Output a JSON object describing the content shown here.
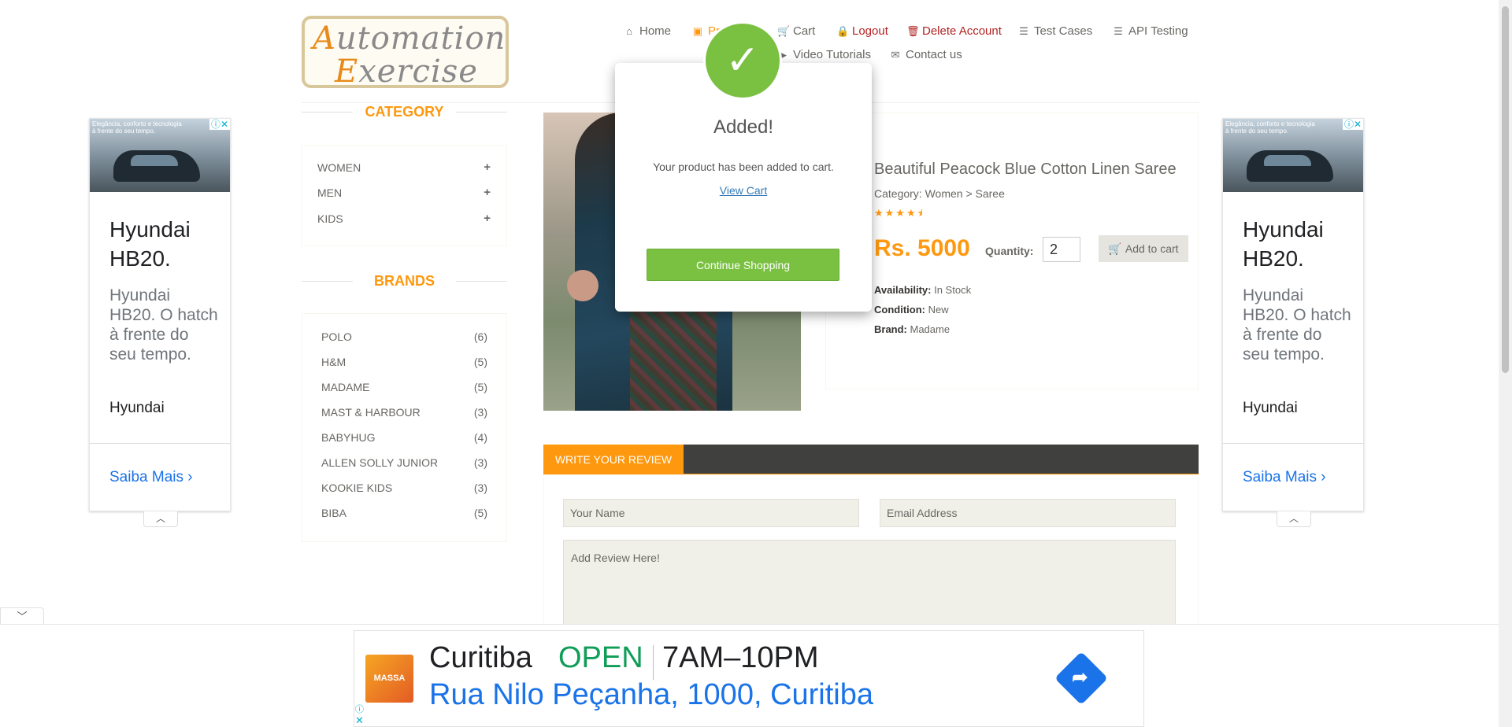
{
  "logo": {
    "line1_cap": "A",
    "line1_rest": "utomation",
    "line2_cap": "E",
    "line2_rest": "xercise"
  },
  "nav": {
    "home": "Home",
    "products": "Products",
    "cart": "Cart",
    "logout": "Logout",
    "delete_account": "Delete Account",
    "test_cases": "Test Cases",
    "api_testing": "API Testing",
    "video_tutorials": "Video Tutorials",
    "contact_us": "Contact us"
  },
  "side_ad": {
    "tagline": "Elegância, conforto e tecnologia à frente do seu tempo.",
    "title": "Hyundai HB20.",
    "description": "Hyundai HB20. O hatch à frente do seu tempo.",
    "brand": "Hyundai",
    "cta": "Saiba Mais"
  },
  "sidebar": {
    "category_title": "CATEGORY",
    "categories": [
      {
        "label": "WOMEN"
      },
      {
        "label": "MEN"
      },
      {
        "label": "KIDS"
      }
    ],
    "brands_title": "BRANDS",
    "brands": [
      {
        "name": "POLO",
        "count": "(6)"
      },
      {
        "name": "H&M",
        "count": "(5)"
      },
      {
        "name": "MADAME",
        "count": "(5)"
      },
      {
        "name": "MAST & HARBOUR",
        "count": "(3)"
      },
      {
        "name": "BABYHUG",
        "count": "(4)"
      },
      {
        "name": "ALLEN SOLLY JUNIOR",
        "count": "(3)"
      },
      {
        "name": "KOOKIE KIDS",
        "count": "(3)"
      },
      {
        "name": "BIBA",
        "count": "(5)"
      }
    ]
  },
  "product": {
    "name": "Beautiful Peacock Blue Cotton Linen Saree",
    "category": "Category: Women > Saree",
    "rating": 4.5,
    "price": "Rs. 5000",
    "quantity_label": "Quantity:",
    "quantity": "2",
    "add_to_cart": "Add to cart",
    "availability_label": "Availability:",
    "availability": " In Stock",
    "condition_label": "Condition:",
    "condition": " New",
    "brand_label": "Brand:",
    "brand": " Madame"
  },
  "review": {
    "tab": "WRITE YOUR REVIEW",
    "name_placeholder": "Your Name",
    "email_placeholder": "Email Address",
    "review_placeholder": "Add Review Here!"
  },
  "modal": {
    "title": "Added!",
    "message": "Your product has been added to cart.",
    "view_cart": "View Cart",
    "continue": "Continue Shopping"
  },
  "bottom_ad": {
    "thumb_label": "MASSA",
    "name": "Curitiba",
    "status": "OPEN",
    "hours": "7AM–10PM",
    "address": "Rua Nilo Peçanha, 1000, Curitiba"
  },
  "colors": {
    "accent": "#fe980f",
    "success": "#7ac142",
    "danger": "#b22222",
    "link": "#1a73e8"
  }
}
